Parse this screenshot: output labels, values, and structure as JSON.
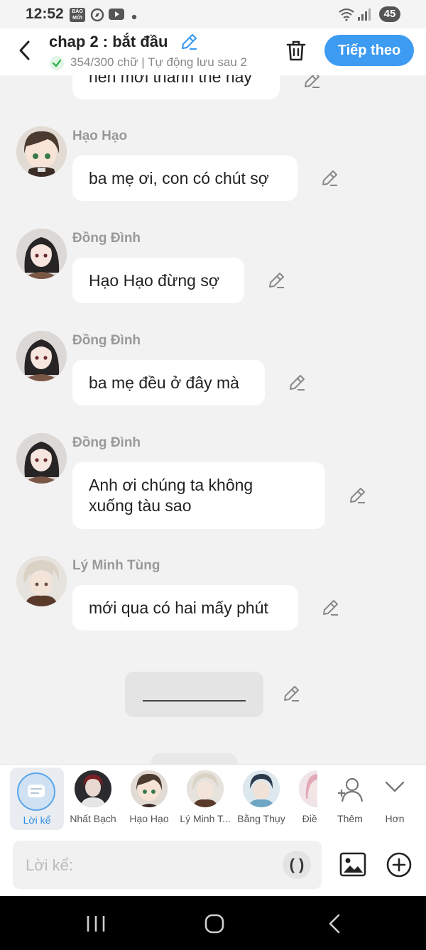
{
  "status_bar": {
    "time": "12:52",
    "baomoi_label": "BÁO MỚI",
    "battery": "45"
  },
  "header": {
    "title": "chap 2 : bắt đầu",
    "save_status": "354/300 chữ | Tự động lưu sau 2",
    "next_label": "Tiếp theo"
  },
  "messages": [
    {
      "speaker": "",
      "text": "nên mới thành thế này"
    },
    {
      "speaker": "Hạo Hạo",
      "text": "ba mẹ ơi, con có chút sợ"
    },
    {
      "speaker": "Đồng Đình",
      "text": "Hạo Hạo đừng sợ"
    },
    {
      "speaker": "Đồng Đình",
      "text": "ba mẹ đều ở đây mà"
    },
    {
      "speaker": "Đồng Đình",
      "text": "Anh ơi chúng ta không xuống tàu sao"
    },
    {
      "speaker": "Lý Minh Tùng",
      "text": "mới qua có hai mấy phút"
    }
  ],
  "characters": [
    {
      "label": "Lời kể"
    },
    {
      "label": "Nhất Bạch"
    },
    {
      "label": "Hạo Hạo"
    },
    {
      "label": "Lý Minh T..."
    },
    {
      "label": "Bằng Thụy"
    },
    {
      "label": "Điền C"
    }
  ],
  "more_actions": {
    "add_label": "Thêm",
    "more_label": "Hơn"
  },
  "input": {
    "placeholder": "Lời kể:",
    "paren_label": "( )"
  },
  "colors": {
    "accent": "#3d9bf2",
    "background": "#f2f2f2",
    "bubble": "#ffffff",
    "speaker_text": "#999999"
  }
}
